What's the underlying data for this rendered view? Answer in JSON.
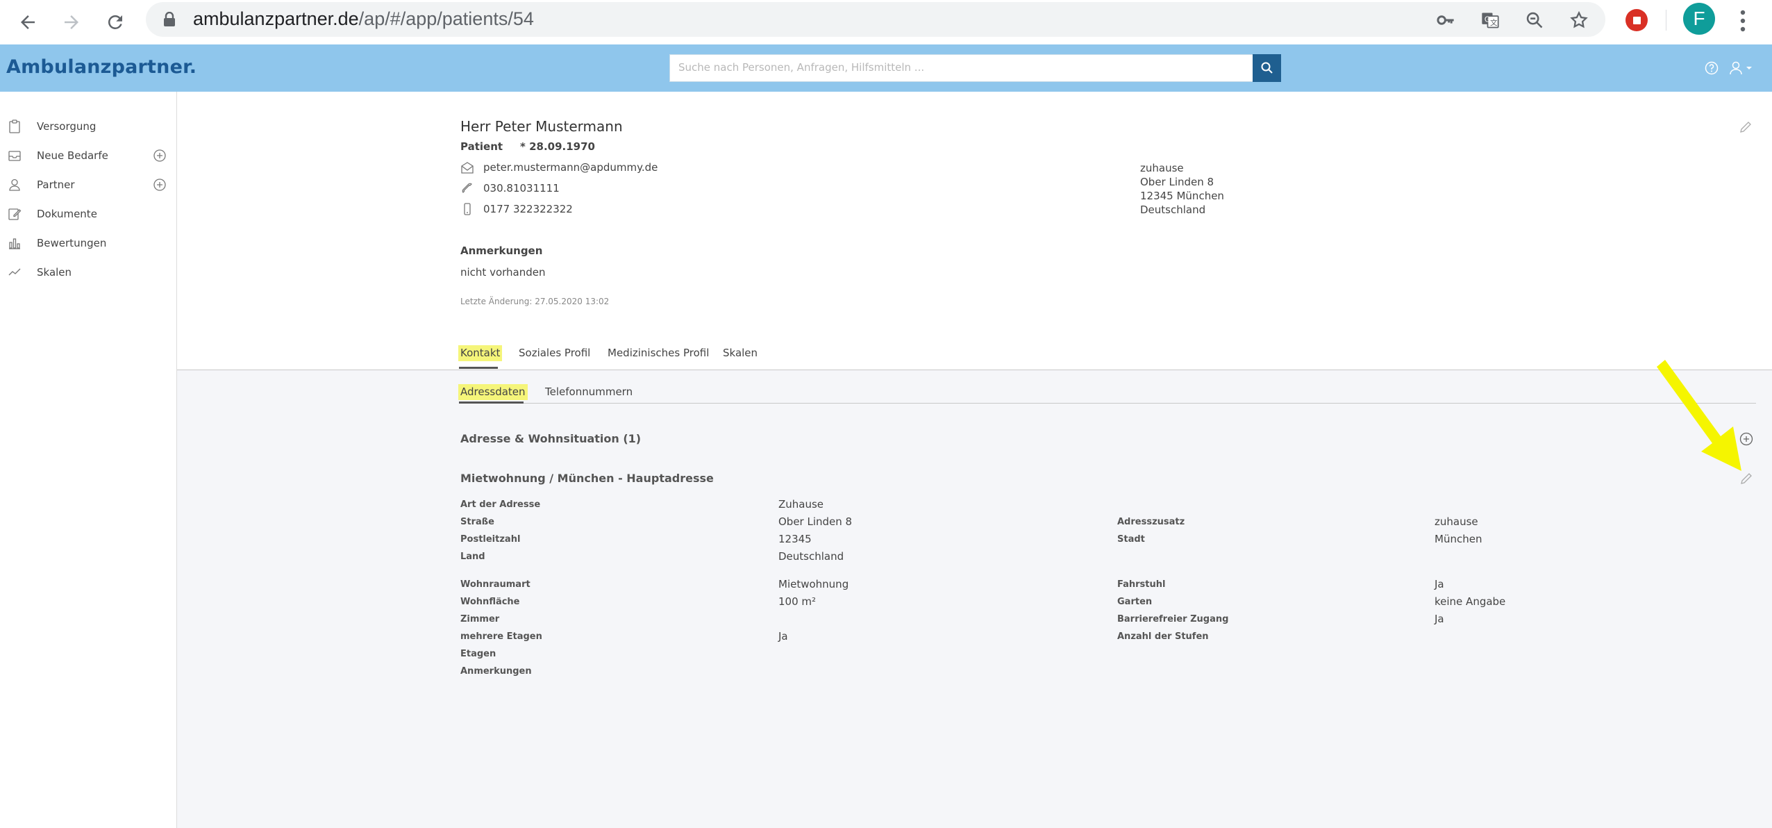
{
  "browser": {
    "url_host": "ambulanzpartner.de",
    "url_path": "/ap/#/app/patients/54",
    "profile_initial": "F"
  },
  "app": {
    "brand": "Ambulanzpartner.",
    "search_placeholder": "Suche nach Personen, Anfragen, Hilfsmitteln ..."
  },
  "sidebar": {
    "items": [
      {
        "label": "Versorgung",
        "icon": "clipboard-icon"
      },
      {
        "label": "Neue Bedarfe",
        "icon": "inbox-icon"
      },
      {
        "label": "Partner",
        "icon": "person-icon"
      },
      {
        "label": "Dokumente",
        "icon": "document-edit-icon"
      },
      {
        "label": "Bewertungen",
        "icon": "bar-chart-icon"
      },
      {
        "label": "Skalen",
        "icon": "line-chart-icon"
      }
    ]
  },
  "patient": {
    "name": "Herr Peter Mustermann",
    "role": "Patient",
    "dob": "* 28.09.1970",
    "email": "peter.mustermann@apdummy.de",
    "phone": "030.81031111",
    "mobile": "0177 322322322",
    "address_lines": [
      "zuhause",
      "Ober Linden 8",
      "12345 München",
      "Deutschland"
    ],
    "notes_label": "Anmerkungen",
    "notes_value": "nicht vorhanden",
    "last_change": "Letzte Änderung: 27.05.2020 13:02"
  },
  "tabs": [
    "Kontakt",
    "Soziales Profil",
    "Medizinisches Profil",
    "Skalen"
  ],
  "subtabs": [
    "Adressdaten",
    "Telefonnummern"
  ],
  "address_section": {
    "title": "Adresse & Wohnsituation (1)",
    "entry_title": "Mietwohnung / München - Hauptadresse",
    "fields_left": [
      {
        "label": "Art der Adresse",
        "value": "Zuhause"
      },
      {
        "label": "Straße",
        "value": "Ober Linden 8"
      },
      {
        "label": "Postleitzahl",
        "value": "12345"
      },
      {
        "label": "Land",
        "value": "Deutschland"
      },
      {
        "label": "Wohnraumart",
        "value": "Mietwohnung"
      },
      {
        "label": "Wohnfläche",
        "value": "100 m²"
      },
      {
        "label": "Zimmer",
        "value": ""
      },
      {
        "label": "mehrere Etagen",
        "value": "Ja"
      },
      {
        "label": "Etagen",
        "value": ""
      },
      {
        "label": "Anmerkungen",
        "value": ""
      }
    ],
    "fields_right": [
      {
        "label": "Adresszusatz",
        "value": "zuhause"
      },
      {
        "label": "Stadt",
        "value": "München"
      },
      {
        "label": "Fahrstuhl",
        "value": "Ja"
      },
      {
        "label": "Garten",
        "value": "keine Angabe"
      },
      {
        "label": "Barrierefreier Zugang",
        "value": "Ja"
      },
      {
        "label": "Anzahl der Stufen",
        "value": ""
      }
    ]
  },
  "colors": {
    "appbar": "#8fc6ec",
    "brand": "#1c5a94",
    "search_button": "#1f5f90",
    "highlight": "#f5f57a",
    "arrow": "#f5f500"
  }
}
